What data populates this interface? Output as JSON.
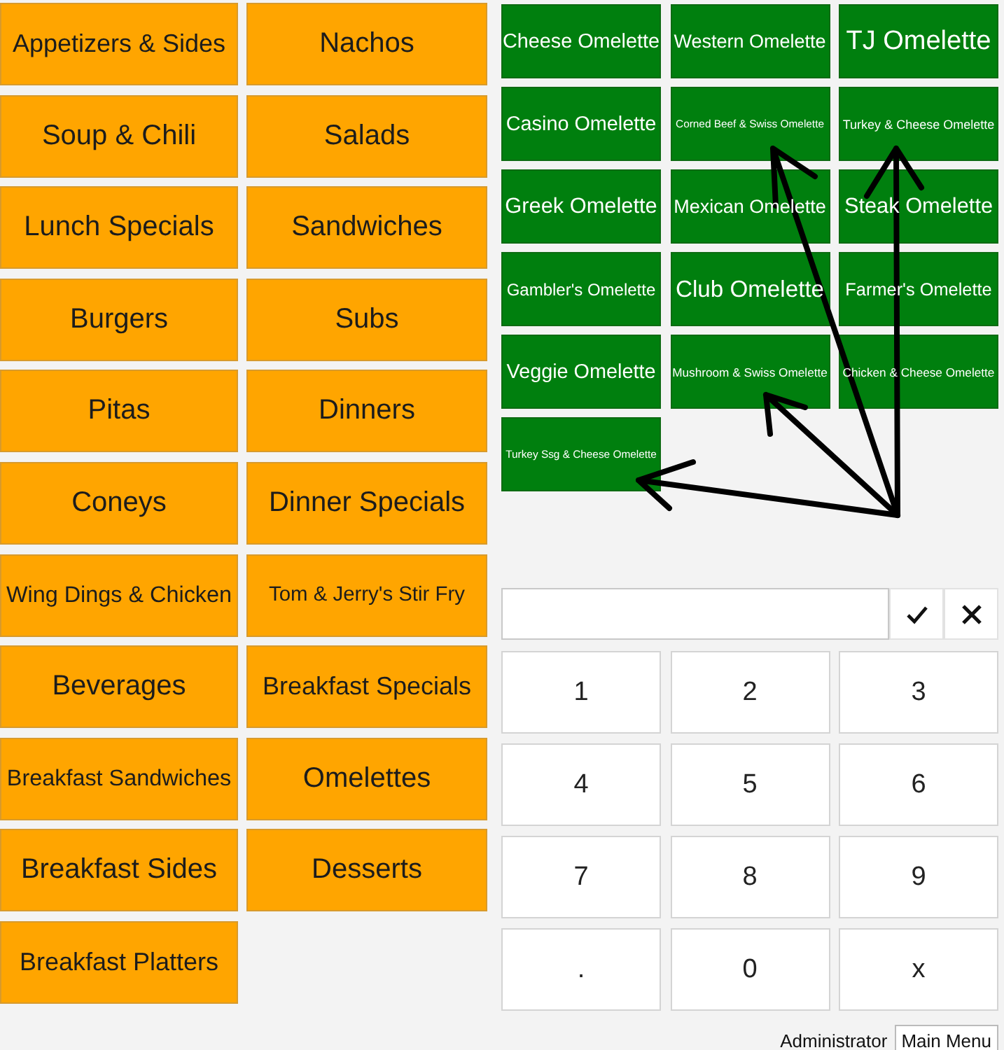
{
  "categories": [
    {
      "label": "Appetizers & Sides"
    },
    {
      "label": "Nachos"
    },
    {
      "label": "Soup & Chili"
    },
    {
      "label": "Salads"
    },
    {
      "label": "Lunch Specials"
    },
    {
      "label": "Sandwiches"
    },
    {
      "label": "Burgers"
    },
    {
      "label": "Subs"
    },
    {
      "label": "Pitas"
    },
    {
      "label": "Dinners"
    },
    {
      "label": "Coneys"
    },
    {
      "label": "Dinner Specials"
    },
    {
      "label": "Wing Dings & Chicken"
    },
    {
      "label": "Tom & Jerry's Stir Fry"
    },
    {
      "label": "Beverages"
    },
    {
      "label": "Breakfast Specials"
    },
    {
      "label": "Breakfast Sandwiches"
    },
    {
      "label": "Omelettes"
    },
    {
      "label": "Breakfast Sides"
    },
    {
      "label": "Desserts"
    },
    {
      "label": "Breakfast Platters"
    }
  ],
  "items": [
    {
      "label": "Cheese Omelette"
    },
    {
      "label": "Western Omelette"
    },
    {
      "label": "TJ Omelette"
    },
    {
      "label": "Casino Omelette"
    },
    {
      "label": "Corned Beef & Swiss Omelette"
    },
    {
      "label": "Turkey & Cheese Omelette"
    },
    {
      "label": "Greek Omelette"
    },
    {
      "label": "Mexican Omelette"
    },
    {
      "label": "Steak Omelette"
    },
    {
      "label": "Gambler's Omelette"
    },
    {
      "label": "Club Omelette"
    },
    {
      "label": "Farmer's Omelette"
    },
    {
      "label": "Veggie Omelette"
    },
    {
      "label": "Mushroom & Swiss Omelette"
    },
    {
      "label": "Chicken & Cheese Omelette"
    },
    {
      "label": "Turkey Ssg & Cheese Omelette"
    }
  ],
  "keypad": [
    "1",
    "2",
    "3",
    "4",
    "5",
    "6",
    "7",
    "8",
    "9",
    ".",
    "0",
    "x"
  ],
  "status_bar": {
    "user": "Administrator",
    "button": "Main Menu"
  }
}
